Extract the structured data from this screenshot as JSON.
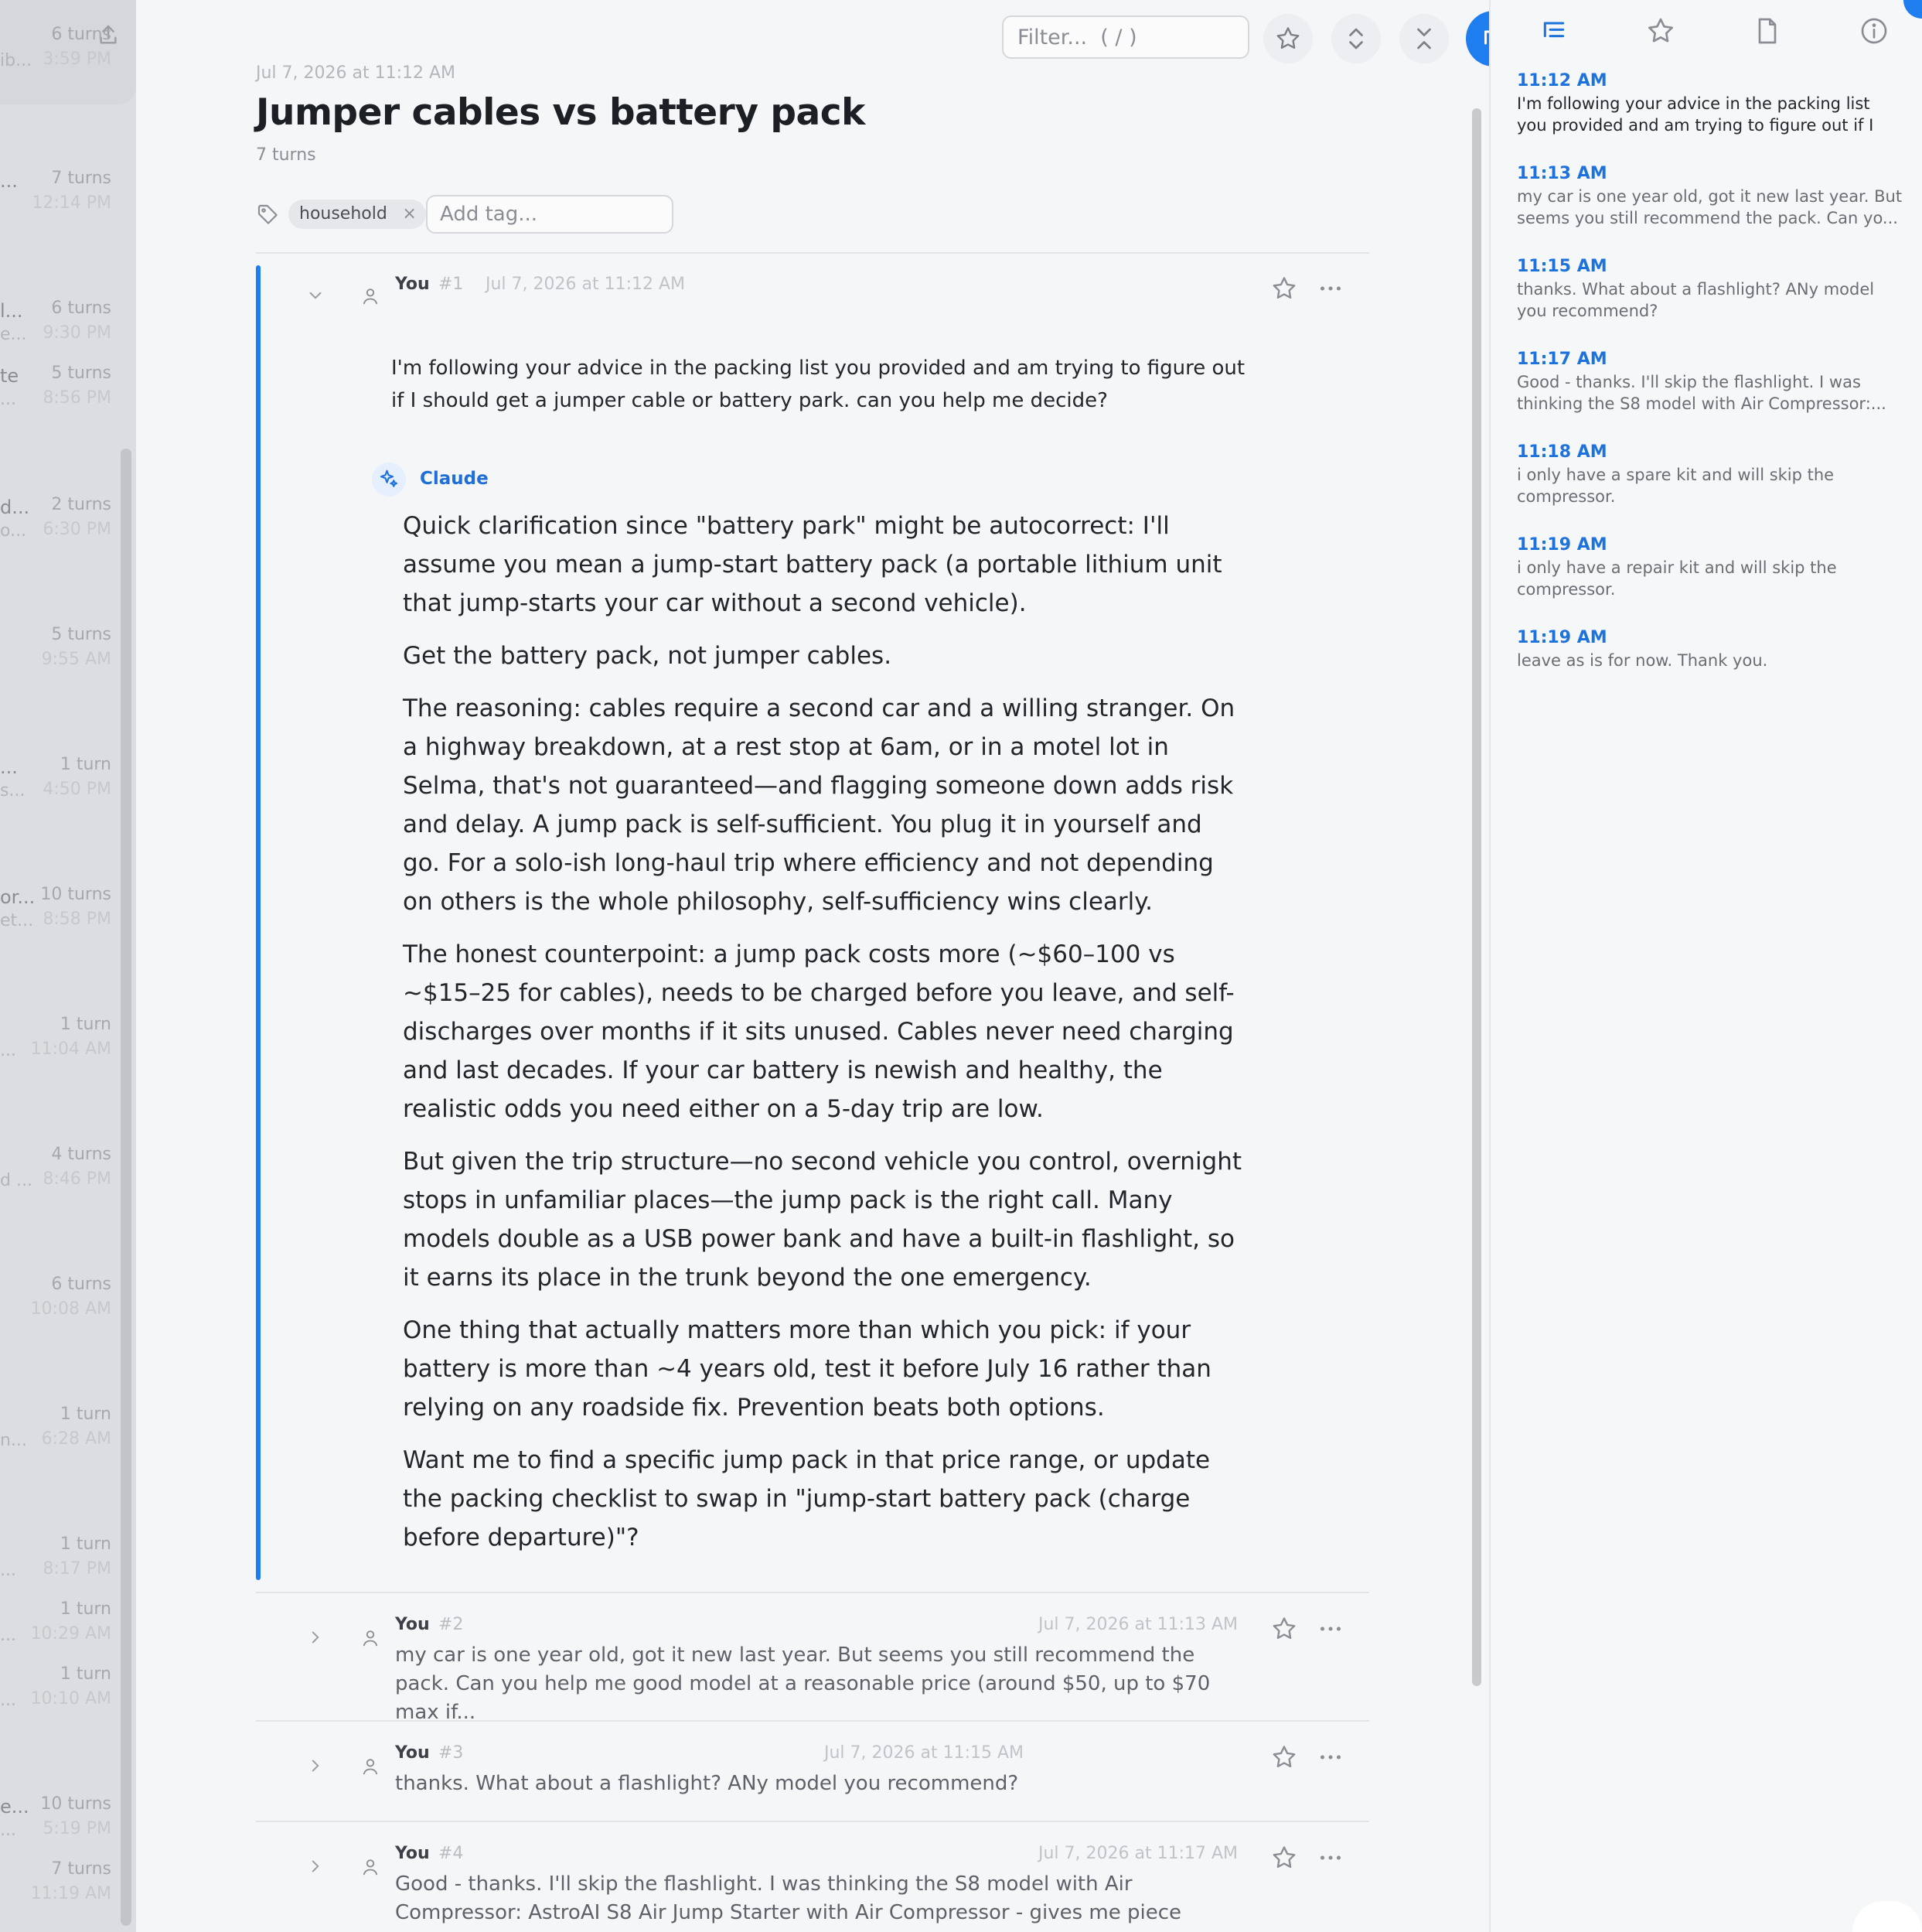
{
  "sidebar": {
    "items": [
      {
        "trunc": "",
        "trunc2": "ib...",
        "turns": "6 turns",
        "time": "3:59 PM"
      },
      {
        "trunc": "...",
        "trunc2": "",
        "turns": "7 turns",
        "time": "12:14 PM"
      },
      {
        "trunc": "l...",
        "trunc2": "e...",
        "turns": "6 turns",
        "time": "9:30 PM"
      },
      {
        "trunc": "te",
        "trunc2": "...",
        "turns": "5 turns",
        "time": "8:56 PM"
      },
      {
        "trunc": "d...",
        "trunc2": "o...",
        "turns": "2 turns",
        "time": "6:30 PM"
      },
      {
        "trunc": "",
        "trunc2": "",
        "turns": "5 turns",
        "time": "9:55 AM"
      },
      {
        "trunc": "...",
        "trunc2": "s...",
        "turns": "1 turn",
        "time": "4:50 PM"
      },
      {
        "trunc": "or...",
        "trunc2": "et...",
        "turns": "10 turns",
        "time": "8:58 PM"
      },
      {
        "trunc": "",
        "trunc2": "...",
        "turns": "1 turn",
        "time": "11:04 AM"
      },
      {
        "trunc": "",
        "trunc2": "d ...",
        "turns": "4 turns",
        "time": "8:46 PM"
      },
      {
        "trunc": "",
        "trunc2": "",
        "turns": "6 turns",
        "time": "10:08 AM"
      },
      {
        "trunc": "",
        "trunc2": "n...",
        "turns": "1 turn",
        "time": "6:28 AM"
      },
      {
        "trunc": "",
        "trunc2": "...",
        "turns": "1 turn",
        "time": "8:17 PM"
      },
      {
        "trunc": "",
        "trunc2": "...",
        "turns": "1 turn",
        "time": "10:29 AM"
      },
      {
        "trunc": "",
        "trunc2": "...",
        "turns": "1 turn",
        "time": "10:10 AM"
      },
      {
        "trunc": "e...",
        "trunc2": "...",
        "turns": "10 turns",
        "time": "5:19 PM"
      },
      {
        "trunc": "",
        "trunc2": "",
        "turns": "7 turns",
        "time": "11:19 AM"
      }
    ]
  },
  "toolbar": {
    "filter_placeholder": "Filter...  ( / )",
    "icons": [
      "star-icon",
      "expand-icon",
      "collapse-icon",
      "outline-icon"
    ]
  },
  "conversation": {
    "date": "Jul 7, 2026 at 11:12 AM",
    "title": "Jumper cables vs battery pack",
    "turns": "7 turns",
    "tag": "household",
    "tag_remove": "×",
    "add_tag_placeholder": "Add tag..."
  },
  "turn1": {
    "speaker": "You",
    "num": "#1",
    "date": "Jul 7, 2026 at 11:12 AM",
    "message": "I'm following your advice in the packing list you provided and am trying to figure out if I should get a jumper cable or battery park. can you help me decide?",
    "assistant": "Claude",
    "reply": [
      "Quick clarification since \"battery park\" might be autocorrect: I'll assume you mean a jump-start battery pack (a portable lithium unit that jump-starts your car without a second vehicle).",
      "Get the battery pack, not jumper cables.",
      "The reasoning: cables require a second car and a willing stranger. On a highway breakdown, at a rest stop at 6am, or in a motel lot in Selma, that's not guaranteed—and flagging someone down adds risk and delay. A jump pack is self-sufficient. You plug it in yourself and go. For a solo-ish long-haul trip where efficiency and not depending on others is the whole philosophy, self-sufficiency wins clearly.",
      "The honest counterpoint: a jump pack costs more (~$60–100 vs ~$15–25 for cables), needs to be charged before you leave, and self-discharges over months if it sits unused. Cables never need charging and last decades. If your car battery is newish and healthy, the realistic odds you need either on a 5-day trip are low.",
      "But given the trip structure—no second vehicle you control, overnight stops in unfamiliar places—the jump pack is the right call. Many models double as a USB power bank and have a built-in flashlight, so it earns its place in the trunk beyond the one emergency.",
      "One thing that actually matters more than which you pick: if your battery is more than ~4 years old, test it before July 16 rather than relying on any roadside fix. Prevention beats both options.",
      "Want me to find a specific jump pack in that price range, or update the packing checklist to swap in \"jump-start battery pack (charge before departure)\"?"
    ]
  },
  "collapsed_turns": [
    {
      "speaker": "You",
      "num": "#2",
      "date": "Jul 7, 2026 at 11:13 AM",
      "preview": "my car is one year old, got it new last year. But seems you still recommend the pack. Can you help me good model at a reasonable price (around $50, up to $70 max if..."
    },
    {
      "speaker": "You",
      "num": "#3",
      "date": "Jul 7, 2026 at 11:15 AM",
      "preview": "thanks. What about a flashlight? ANy model you recommend?"
    },
    {
      "speaker": "You",
      "num": "#4",
      "date": "Jul 7, 2026 at 11:17 AM",
      "preview": "Good - thanks. I'll skip the flashlight. I was thinking the S8 model with Air Compressor: AstroAI S8 Air Jump Starter with Air Compressor - gives me piece of..."
    }
  ],
  "outline": {
    "tabs": [
      "outline-list-icon",
      "star-icon",
      "document-icon",
      "info-icon"
    ],
    "entries": [
      {
        "time": "11:12 AM",
        "text": "I'm following your advice in the packing list you provided and am trying to figure out if I shoul..."
      },
      {
        "time": "11:13 AM",
        "text": "my car is one year old, got it new last year. But seems you still recommend the pack. Can yo..."
      },
      {
        "time": "11:15 AM",
        "text": "thanks. What about a flashlight? ANy model you recommend?"
      },
      {
        "time": "11:17 AM",
        "text": "Good - thanks. I'll skip the flashlight. I was thinking the S8 model with Air Compressor:..."
      },
      {
        "time": "11:18 AM",
        "text": "i only have a spare kit and will skip the compressor."
      },
      {
        "time": "11:19 AM",
        "text": "i only have a repair kit and will skip the compressor."
      },
      {
        "time": "11:19 AM",
        "text": "leave as is for now. Thank you."
      }
    ]
  },
  "colors": {
    "accent": "#1e7ef0",
    "link": "#1e72dc"
  }
}
